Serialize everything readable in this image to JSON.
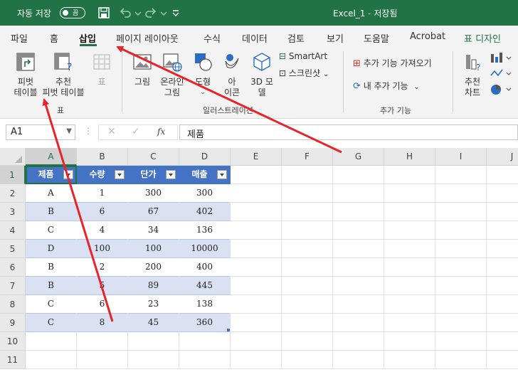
{
  "titlebar": {
    "autosave_label": "자동 저장",
    "autosave_state": "끔",
    "window_title": "Excel_1 - 저장됨",
    "bg_color": "#217346"
  },
  "tabs": [
    "파일",
    "홈",
    "삽입",
    "페이지 레이아웃",
    "수식",
    "데이터",
    "검토",
    "보기",
    "도움말",
    "Acrobat",
    "표 디자인"
  ],
  "active_tab": "삽입",
  "ribbon": {
    "pivot_line1": "피벗",
    "pivot_line2": "테이블",
    "rec_pivot_line1": "추천",
    "rec_pivot_line2": "피벗 테이블",
    "table_label": "표",
    "group_tables": "표",
    "pictures": "그림",
    "online_pictures_line1": "온라인",
    "online_pictures_line2": "그림",
    "shapes": "도형",
    "icons_line1": "아",
    "icons_line2": "이콘",
    "models_line1": "3D 모",
    "models_line2": "델",
    "smartart": "SmartArt",
    "screenshot": "스크린샷",
    "group_illustrations": "일러스트레이션",
    "get_addins": "추가 기능 가져오기",
    "my_addins": "내 추가 기능",
    "group_addins": "추가 기능",
    "rec_charts_line1": "추천",
    "rec_charts_line2": "차트"
  },
  "formula_bar": {
    "name_box": "A1",
    "fx": "fx",
    "content": "제품"
  },
  "columns": [
    "A",
    "B",
    "C",
    "D",
    "E",
    "F",
    "G",
    "H",
    "I",
    "J"
  ],
  "rows": [
    "1",
    "2",
    "3",
    "4",
    "5",
    "6",
    "7",
    "8",
    "9",
    "10",
    "11"
  ],
  "table": {
    "headers": [
      "제품",
      "수량",
      "단가",
      "매출"
    ],
    "rows": [
      [
        "A",
        "1",
        "300",
        "300"
      ],
      [
        "B",
        "6",
        "67",
        "402"
      ],
      [
        "C",
        "4",
        "34",
        "136"
      ],
      [
        "D",
        "100",
        "100",
        "10000"
      ],
      [
        "B",
        "2",
        "200",
        "400"
      ],
      [
        "B",
        "5",
        "89",
        "445"
      ],
      [
        "C",
        "6",
        "23",
        "138"
      ],
      [
        "C",
        "8",
        "45",
        "360"
      ]
    ],
    "header_color": "#4472c4",
    "band_color": "#d9e1f2"
  },
  "annotation_color": "#e8242b"
}
